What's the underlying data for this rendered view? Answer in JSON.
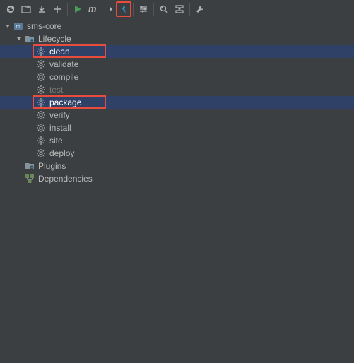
{
  "toolbar": {
    "buttons": [
      {
        "name": "refresh-icon",
        "sep": false
      },
      {
        "name": "add-project-icon",
        "sep": false
      },
      {
        "name": "download-icon",
        "sep": false
      },
      {
        "name": "add-icon",
        "sep": true
      },
      {
        "name": "run-icon",
        "sep": false,
        "color": "c-green"
      },
      {
        "name": "m-icon",
        "sep": false
      },
      {
        "name": "skip-tests-icon",
        "sep": false
      },
      {
        "name": "offline-icon",
        "sep": true,
        "highlight": true,
        "color": "c-teal"
      },
      {
        "name": "settings-sliders-icon",
        "sep": true
      },
      {
        "name": "find-icon",
        "sep": false
      },
      {
        "name": "collapse-icon",
        "sep": true
      },
      {
        "name": "wrench-icon",
        "sep": false
      }
    ]
  },
  "tree": {
    "root": {
      "label": "sms-core",
      "expanded": true,
      "icon": "maven-project-icon",
      "children": [
        {
          "label": "Lifecycle",
          "expanded": true,
          "icon": "folder-cycle-icon",
          "children": [
            {
              "label": "clean",
              "icon": "gear-icon",
              "selected": true,
              "redbox": true
            },
            {
              "label": "validate",
              "icon": "gear-icon"
            },
            {
              "label": "compile",
              "icon": "gear-icon"
            },
            {
              "label": "test",
              "icon": "gear-icon",
              "dim": true
            },
            {
              "label": "package",
              "icon": "gear-icon",
              "selected": true,
              "redbox": true
            },
            {
              "label": "verify",
              "icon": "gear-icon"
            },
            {
              "label": "install",
              "icon": "gear-icon"
            },
            {
              "label": "site",
              "icon": "gear-icon"
            },
            {
              "label": "deploy",
              "icon": "gear-icon"
            }
          ]
        },
        {
          "label": "Plugins",
          "expanded": false,
          "icon": "folder-plugins-icon"
        },
        {
          "label": "Dependencies",
          "expanded": false,
          "icon": "deps-icon"
        }
      ]
    }
  }
}
